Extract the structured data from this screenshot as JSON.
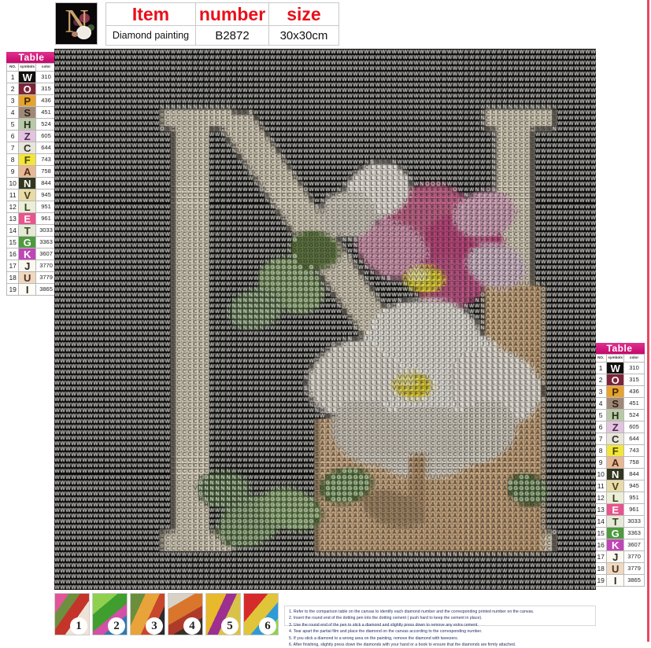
{
  "product": {
    "logo_letter": "N",
    "header": {
      "columns": [
        "Item",
        "number",
        "size"
      ],
      "values": [
        "Diamond painting",
        "B2872",
        "30x30cm"
      ]
    }
  },
  "legend": {
    "title": "Table",
    "columns": [
      "NO.",
      "symbols",
      "color"
    ],
    "rows": [
      {
        "no": "1",
        "symbol": "W",
        "color": "310",
        "bg": "#100f0d",
        "fg": "#ffffff"
      },
      {
        "no": "2",
        "symbol": "O",
        "color": "315",
        "bg": "#7e2438",
        "fg": "#ffffff"
      },
      {
        "no": "3",
        "symbol": "P",
        "color": "436",
        "bg": "#e8a32c",
        "fg": "#3a2a05"
      },
      {
        "no": "4",
        "symbol": "S",
        "color": "451",
        "bg": "#a08878",
        "fg": "#2b1e16"
      },
      {
        "no": "5",
        "symbol": "H",
        "color": "524",
        "bg": "#b9c9a8",
        "fg": "#24301c"
      },
      {
        "no": "6",
        "symbol": "Z",
        "color": "605",
        "bg": "#e2c3e0",
        "fg": "#4a2a48"
      },
      {
        "no": "7",
        "symbol": "C",
        "color": "644",
        "bg": "#e8e6da",
        "fg": "#333026"
      },
      {
        "no": "8",
        "symbol": "F",
        "color": "743",
        "bg": "#f2e63a",
        "fg": "#4a4405"
      },
      {
        "no": "9",
        "symbol": "A",
        "color": "758",
        "bg": "#e8b894",
        "fg": "#4a2d18"
      },
      {
        "no": "10",
        "symbol": "N",
        "color": "844",
        "bg": "#33361f",
        "fg": "#ffffff"
      },
      {
        "no": "11",
        "symbol": "V",
        "color": "945",
        "bg": "#e8dba8",
        "fg": "#4a4018"
      },
      {
        "no": "12",
        "symbol": "L",
        "color": "951",
        "bg": "#ecefd8",
        "fg": "#3a4020"
      },
      {
        "no": "13",
        "symbol": "E",
        "color": "961",
        "bg": "#e8548c",
        "fg": "#ffffff"
      },
      {
        "no": "14",
        "symbol": "T",
        "color": "3033",
        "bg": "#e4ead6",
        "fg": "#3a4026"
      },
      {
        "no": "15",
        "symbol": "G",
        "color": "3363",
        "bg": "#4e9a3e",
        "fg": "#ffffff"
      },
      {
        "no": "16",
        "symbol": "K",
        "color": "3607",
        "bg": "#c046b8",
        "fg": "#ffffff"
      },
      {
        "no": "17",
        "symbol": "J",
        "color": "3770",
        "bg": "#fbf8ef",
        "fg": "#2e2a20"
      },
      {
        "no": "18",
        "symbol": "U",
        "color": "3779",
        "bg": "#f0d8c0",
        "fg": "#4a3020"
      },
      {
        "no": "19",
        "symbol": "I",
        "color": "3865",
        "bg": "#fdfcf6",
        "fg": "#2e2a20"
      }
    ]
  },
  "thumbnails": [
    {
      "badge": "1"
    },
    {
      "badge": "2"
    },
    {
      "badge": "3"
    },
    {
      "badge": "4"
    },
    {
      "badge": "5"
    },
    {
      "badge": "6"
    }
  ],
  "instructions": [
    "1. Refer to the comparison table on the canvas to identify each diamond number and the corresponding printed number on the canvas.",
    "2. Insert the round end of the dotting pen into the dotting cement ( push hard to keep the cement in place).",
    "3. Use the round end of the pen to stick a diamond and slightly press down to remove any extra cement.",
    "4. Tear apart the partial film and place the diamond on the canvas according to the corresponding number.",
    "5. If you stick a diamond to a wrong area on the painting, remove the diamond with tweezers.",
    "6. After finishing, slightly press down the diamonds with your hand or a book to ensure that the diamonds are firmly attached."
  ],
  "canvas": {
    "cols": 98,
    "rows": 98,
    "background_color": "#0b0a09",
    "palette": {
      "W": "#100f0d",
      "O": "#7e2438",
      "P": "#e8a32c",
      "S": "#a08878",
      "H": "#b9c9a8",
      "Z": "#e2c3e0",
      "C": "#e8e6da",
      "F": "#f2e63a",
      "A": "#e8b894",
      "N": "#33361f",
      "V": "#e8dba8",
      "L": "#ecefd8",
      "E": "#e8548c",
      "T": "#e4ead6",
      "G": "#4e9a3e",
      "K": "#c046b8",
      "J": "#fbf8ef",
      "U": "#f0d8c0",
      "I": "#fdfcf6"
    },
    "regions": {
      "letter_n": {
        "symbols": [
          "J",
          "I",
          "U",
          "A",
          "V",
          "L",
          "T"
        ]
      },
      "white_flower": {
        "symbols": [
          "I",
          "J",
          "T",
          "C",
          "L"
        ]
      },
      "flower_center": {
        "symbols": [
          "F",
          "P",
          "V",
          "A"
        ]
      },
      "pink_flower": {
        "symbols": [
          "E",
          "Z",
          "K",
          "O"
        ]
      },
      "foliage": {
        "symbols": [
          "G",
          "N",
          "H",
          "S"
        ]
      }
    }
  }
}
